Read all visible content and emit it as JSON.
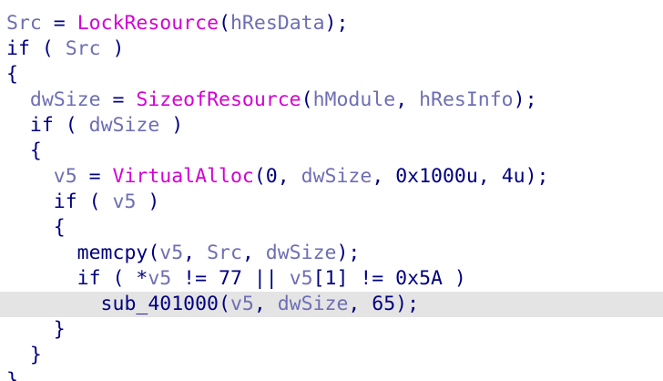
{
  "colors": {
    "background": "#ffffff",
    "highlight_line": "#e4e4e4",
    "keyword": "#000080",
    "variable": "#6e6eb4",
    "function_call": "#d400d4"
  },
  "code": {
    "highlighted_line": 11,
    "lines": [
      {
        "tokens": [
          {
            "t": "var",
            "v": "Src"
          },
          {
            "t": "plain",
            "v": " = "
          },
          {
            "t": "func",
            "v": "LockResource"
          },
          {
            "t": "plain",
            "v": "("
          },
          {
            "t": "var",
            "v": "hResData"
          },
          {
            "t": "plain",
            "v": ");"
          }
        ]
      },
      {
        "tokens": [
          {
            "t": "kw",
            "v": "if"
          },
          {
            "t": "plain",
            "v": " ( "
          },
          {
            "t": "var",
            "v": "Src"
          },
          {
            "t": "plain",
            "v": " )"
          }
        ]
      },
      {
        "tokens": [
          {
            "t": "plain",
            "v": "{"
          }
        ]
      },
      {
        "tokens": [
          {
            "t": "plain",
            "v": "  "
          },
          {
            "t": "var",
            "v": "dwSize"
          },
          {
            "t": "plain",
            "v": " = "
          },
          {
            "t": "func",
            "v": "SizeofResource"
          },
          {
            "t": "plain",
            "v": "("
          },
          {
            "t": "var",
            "v": "hModule"
          },
          {
            "t": "plain",
            "v": ", "
          },
          {
            "t": "var",
            "v": "hResInfo"
          },
          {
            "t": "plain",
            "v": ");"
          }
        ]
      },
      {
        "tokens": [
          {
            "t": "plain",
            "v": "  "
          },
          {
            "t": "kw",
            "v": "if"
          },
          {
            "t": "plain",
            "v": " ( "
          },
          {
            "t": "var",
            "v": "dwSize"
          },
          {
            "t": "plain",
            "v": " )"
          }
        ]
      },
      {
        "tokens": [
          {
            "t": "plain",
            "v": "  {"
          }
        ]
      },
      {
        "tokens": [
          {
            "t": "plain",
            "v": "    "
          },
          {
            "t": "var",
            "v": "v5"
          },
          {
            "t": "plain",
            "v": " = "
          },
          {
            "t": "func",
            "v": "VirtualAlloc"
          },
          {
            "t": "plain",
            "v": "(0, "
          },
          {
            "t": "var",
            "v": "dwSize"
          },
          {
            "t": "plain",
            "v": ", 0x1000u, 4u);"
          }
        ]
      },
      {
        "tokens": [
          {
            "t": "plain",
            "v": "    "
          },
          {
            "t": "kw",
            "v": "if"
          },
          {
            "t": "plain",
            "v": " ( "
          },
          {
            "t": "var",
            "v": "v5"
          },
          {
            "t": "plain",
            "v": " )"
          }
        ]
      },
      {
        "tokens": [
          {
            "t": "plain",
            "v": "    {"
          }
        ]
      },
      {
        "tokens": [
          {
            "t": "plain",
            "v": "      memcpy("
          },
          {
            "t": "var",
            "v": "v5"
          },
          {
            "t": "plain",
            "v": ", "
          },
          {
            "t": "var",
            "v": "Src"
          },
          {
            "t": "plain",
            "v": ", "
          },
          {
            "t": "var",
            "v": "dwSize"
          },
          {
            "t": "plain",
            "v": ");"
          }
        ]
      },
      {
        "tokens": [
          {
            "t": "plain",
            "v": "      "
          },
          {
            "t": "kw",
            "v": "if"
          },
          {
            "t": "plain",
            "v": " ( *"
          },
          {
            "t": "var",
            "v": "v5"
          },
          {
            "t": "plain",
            "v": " != 77 || "
          },
          {
            "t": "var",
            "v": "v5"
          },
          {
            "t": "plain",
            "v": "[1] != 0x5A )"
          }
        ]
      },
      {
        "tokens": [
          {
            "t": "plain",
            "v": "        sub_401000("
          },
          {
            "t": "var",
            "v": "v5"
          },
          {
            "t": "plain",
            "v": ", "
          },
          {
            "t": "var",
            "v": "dwSize"
          },
          {
            "t": "plain",
            "v": ", 65);"
          }
        ]
      },
      {
        "tokens": [
          {
            "t": "plain",
            "v": "    }"
          }
        ]
      },
      {
        "tokens": [
          {
            "t": "plain",
            "v": "  }"
          }
        ]
      },
      {
        "tokens": [
          {
            "t": "plain",
            "v": "}"
          }
        ]
      }
    ]
  }
}
